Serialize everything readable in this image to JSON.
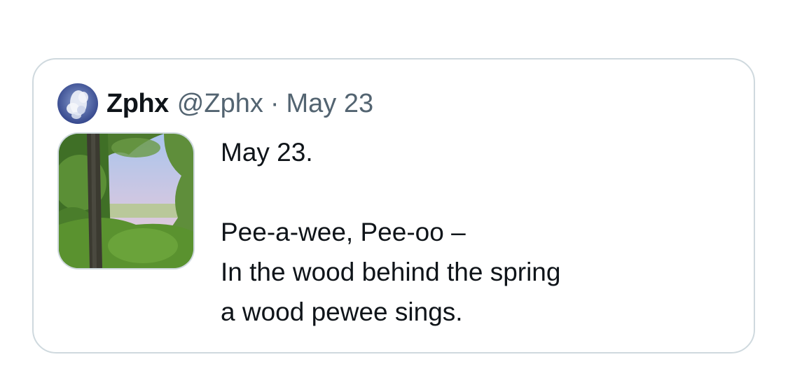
{
  "tweet": {
    "display_name": "Zphx",
    "handle": "@Zphx",
    "separator": "·",
    "date": "May 23",
    "lines": [
      "May 23.",
      "",
      "Pee-a-wee, Pee-oo –",
      "In the wood behind the spring",
      "a wood pewee sings."
    ],
    "avatar_icon": "cloud-sky-avatar-icon",
    "media": "forest-view-thumbnail"
  },
  "colors": {
    "text_primary": "#0f1419",
    "text_secondary": "#536471",
    "border": "#cfd9de"
  }
}
